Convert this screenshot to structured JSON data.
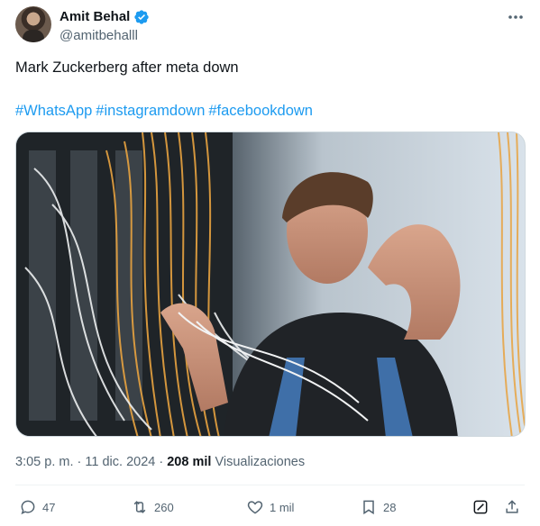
{
  "author": {
    "name": "Amit Behal",
    "handle": "@amitbehalll",
    "verified_color": "#1d9bf0"
  },
  "tweet": {
    "text": "Mark Zuckerberg after meta down",
    "hashtags": [
      "#WhatsApp",
      "#instagramdown",
      "#facebookdown"
    ],
    "hashtag_color": "#1d9bf0"
  },
  "meta": {
    "time": "3:05 p. m.",
    "separator": "·",
    "date": "11 dic. 2024",
    "views_count": "208 mil",
    "views_label": "Visualizaciones"
  },
  "actions": {
    "replies": "47",
    "reposts": "260",
    "likes": "1 mil",
    "bookmarks": "28"
  },
  "icons": {
    "more": "more-horizontal-icon",
    "reply": "reply-bubble-icon",
    "repost": "repost-icon",
    "like": "heart-icon",
    "bookmark": "bookmark-icon",
    "grok": "grok-icon",
    "share": "share-upload-icon",
    "verified": "verified-badge-icon"
  }
}
